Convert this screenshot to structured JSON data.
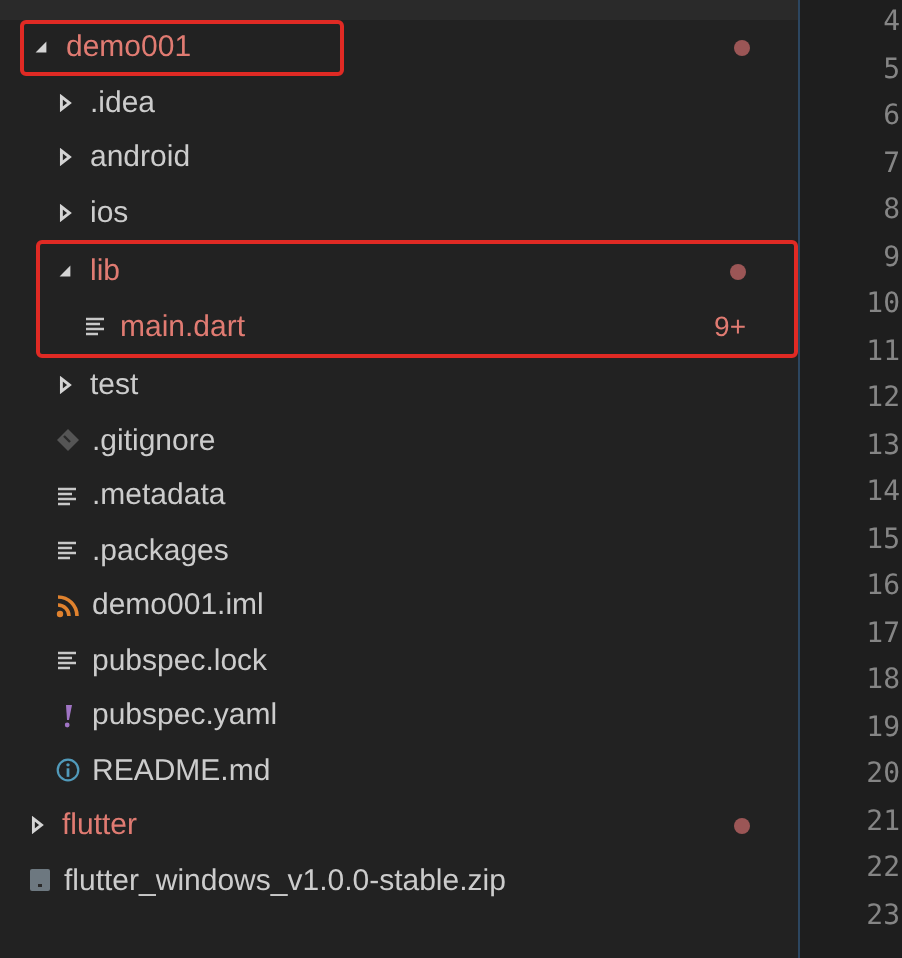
{
  "explorer": {
    "tree": [
      {
        "name": "demo001",
        "kind": "folder",
        "expanded": true,
        "modified": true,
        "boxed": true,
        "box_includes_children": false,
        "children": [
          {
            "name": ".idea",
            "kind": "folder",
            "expanded": false,
            "modified": false
          },
          {
            "name": "android",
            "kind": "folder",
            "expanded": false,
            "modified": false
          },
          {
            "name": "ios",
            "kind": "folder",
            "expanded": false,
            "modified": false
          },
          {
            "name": "lib",
            "kind": "folder",
            "expanded": true,
            "modified": true,
            "boxed": true,
            "box_includes_children": true,
            "children": [
              {
                "name": "main.dart",
                "kind": "text",
                "modified": true,
                "problems": "9+"
              }
            ]
          },
          {
            "name": "test",
            "kind": "folder",
            "expanded": false,
            "modified": false
          },
          {
            "name": ".gitignore",
            "kind": "git",
            "modified": false
          },
          {
            "name": ".metadata",
            "kind": "text",
            "modified": false
          },
          {
            "name": ".packages",
            "kind": "text",
            "modified": false
          },
          {
            "name": "demo001.iml",
            "kind": "xml",
            "modified": false
          },
          {
            "name": "pubspec.lock",
            "kind": "text",
            "modified": false
          },
          {
            "name": "pubspec.yaml",
            "kind": "yaml",
            "modified": false
          },
          {
            "name": "README.md",
            "kind": "info",
            "modified": false
          }
        ]
      },
      {
        "name": "flutter",
        "kind": "folder",
        "expanded": false,
        "modified": true
      },
      {
        "name": "flutter_windows_v1.0.0-stable.zip",
        "kind": "archive",
        "modified": false
      }
    ]
  },
  "editor": {
    "line_numbers": [
      "4",
      "5",
      "6",
      "7",
      "8",
      "9",
      "10",
      "11",
      "12",
      "13",
      "14",
      "15",
      "16",
      "17",
      "18",
      "19",
      "20",
      "21",
      "22",
      "23"
    ]
  }
}
